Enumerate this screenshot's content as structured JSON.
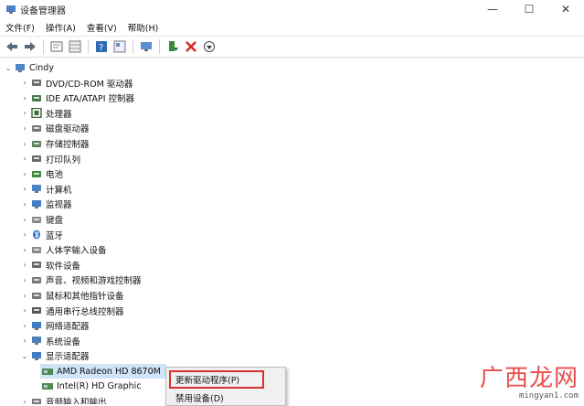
{
  "window": {
    "title": "设备管理器",
    "controls": [
      "—",
      "☐",
      "✕"
    ]
  },
  "menu": [
    "文件(F)",
    "操作(A)",
    "查看(V)",
    "帮助(H)"
  ],
  "toolbar_icons": [
    "back-arrow-icon",
    "forward-arrow-icon",
    "sep",
    "properties-icon",
    "grid-icon",
    "sep",
    "help-icon",
    "grid2-icon",
    "sep",
    "monitor-icon",
    "sep",
    "add-driver-icon",
    "uninstall-x-icon",
    "scan-icon"
  ],
  "tree": {
    "root": "Cindy",
    "items": [
      {
        "label": "DVD/CD-ROM 驱动器",
        "icon": "dvd-drive-icon",
        "expanded": false
      },
      {
        "label": "IDE ATA/ATAPI 控制器",
        "icon": "ide-controller-icon",
        "expanded": false
      },
      {
        "label": "处理器",
        "icon": "processor-icon",
        "expanded": false
      },
      {
        "label": "磁盘驱动器",
        "icon": "disk-drive-icon",
        "expanded": false
      },
      {
        "label": "存储控制器",
        "icon": "storage-controller-icon",
        "expanded": false
      },
      {
        "label": "打印队列",
        "icon": "printer-icon",
        "expanded": false
      },
      {
        "label": "电池",
        "icon": "battery-icon",
        "expanded": false
      },
      {
        "label": "计算机",
        "icon": "computer-icon",
        "expanded": false
      },
      {
        "label": "监视器",
        "icon": "monitor-icon",
        "expanded": false
      },
      {
        "label": "键盘",
        "icon": "keyboard-icon",
        "expanded": false
      },
      {
        "label": "蓝牙",
        "icon": "bluetooth-icon",
        "expanded": false
      },
      {
        "label": "人体学输入设备",
        "icon": "hid-icon",
        "expanded": false
      },
      {
        "label": "软件设备",
        "icon": "software-device-icon",
        "expanded": false
      },
      {
        "label": "声音、视频和游戏控制器",
        "icon": "sound-icon",
        "expanded": false
      },
      {
        "label": "鼠标和其他指针设备",
        "icon": "mouse-icon",
        "expanded": false
      },
      {
        "label": "通用串行总线控制器",
        "icon": "usb-icon",
        "expanded": false
      },
      {
        "label": "网络适配器",
        "icon": "network-adapter-icon",
        "expanded": false
      },
      {
        "label": "系统设备",
        "icon": "system-device-icon",
        "expanded": false
      },
      {
        "label": "显示适配器",
        "icon": "display-adapter-icon",
        "expanded": true
      }
    ],
    "children": [
      {
        "label": "AMD Radeon HD 8670M",
        "icon": "display-card-icon",
        "selected": true
      },
      {
        "label": "Intel(R) HD Graphic",
        "icon": "display-card-icon",
        "selected": false
      }
    ],
    "after": {
      "label": "音频输入和输出",
      "icon": "audio-io-icon"
    }
  },
  "context_menu": {
    "items": [
      "更新驱动程序(P)",
      "禁用设备(D)"
    ],
    "highlighted_index": 0
  },
  "watermark": {
    "text": "广西龙网",
    "url": "mingyan1.com"
  },
  "colors": {
    "selection": "#cfe4f7",
    "highlight_border": "#d83030",
    "watermark": "#e84d4d"
  }
}
